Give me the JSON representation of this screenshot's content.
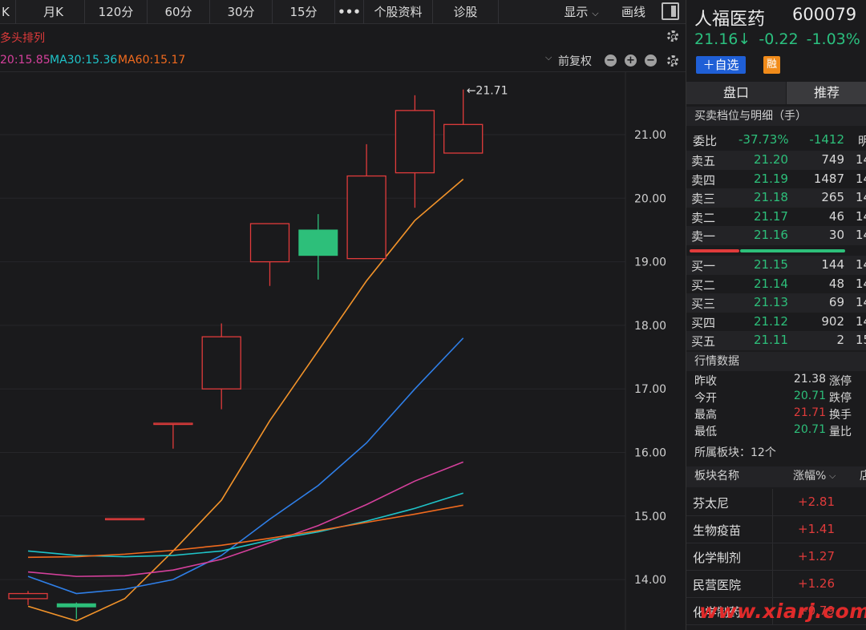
{
  "toolbar": {
    "left_stub": "K",
    "tabs": [
      "月K",
      "120分",
      "60分",
      "30分",
      "15分",
      "•••",
      "个股资料",
      "诊股"
    ],
    "display_label": "显示",
    "draw_label": "画线"
  },
  "indicator_bar": {
    "pattern_label": "多头排列",
    "ma20": "20:15.85",
    "ma30": "MA30:15.36",
    "ma60": "MA60:15.17",
    "adjust_label": "前复权"
  },
  "colors": {
    "up": "#e03b3b",
    "down": "#2dbf7a",
    "ma5": "#f2932a",
    "ma10": "#2f7fe8",
    "ma20": "#d5409c",
    "ma30": "#1fc3c8",
    "ma60": "#f06a1e",
    "axis_text": "#cfcfcf"
  },
  "chart_data": {
    "type": "candlestick",
    "y_ticks": [
      "21.00",
      "20.00",
      "19.00",
      "18.00",
      "17.00",
      "16.00",
      "15.00",
      "14.00"
    ],
    "ylim": [
      13.2,
      22.0
    ],
    "high_annotation": "←21.71",
    "candles": [
      {
        "open": 13.78,
        "close": 13.7,
        "high": 13.82,
        "low": 13.6,
        "dir": "up"
      },
      {
        "open": 13.62,
        "close": 13.57,
        "high": 13.64,
        "low": 13.38,
        "dir": "down"
      },
      {
        "open": 14.95,
        "close": 14.96,
        "high": 14.96,
        "low": 14.95,
        "dir": "up"
      },
      {
        "open": 16.45,
        "close": 16.46,
        "high": 16.46,
        "low": 16.06,
        "dir": "up"
      },
      {
        "open": 17.0,
        "close": 17.82,
        "high": 18.03,
        "low": 16.68,
        "dir": "up"
      },
      {
        "open": 19.0,
        "close": 19.6,
        "high": 19.6,
        "low": 18.62,
        "dir": "up"
      },
      {
        "open": 19.5,
        "close": 19.1,
        "high": 19.75,
        "low": 18.72,
        "dir": "down"
      },
      {
        "open": 19.05,
        "close": 20.35,
        "high": 20.85,
        "low": 19.05,
        "dir": "up"
      },
      {
        "open": 20.4,
        "close": 21.38,
        "high": 21.62,
        "low": 19.85,
        "dir": "up"
      },
      {
        "open": 20.71,
        "close": 21.16,
        "high": 21.71,
        "low": 20.71,
        "dir": "up"
      }
    ],
    "series": [
      {
        "key": "ma5",
        "values": [
          13.58,
          13.35,
          13.7,
          14.45,
          15.25,
          16.5,
          17.6,
          18.7,
          19.65,
          20.3
        ]
      },
      {
        "key": "ma10",
        "values": [
          14.05,
          13.78,
          13.85,
          14.0,
          14.38,
          14.95,
          15.48,
          16.15,
          17.0,
          17.8
        ]
      },
      {
        "key": "ma20",
        "values": [
          14.12,
          14.05,
          14.06,
          14.15,
          14.32,
          14.58,
          14.85,
          15.18,
          15.55,
          15.85
        ]
      },
      {
        "key": "ma30",
        "values": [
          14.45,
          14.38,
          14.36,
          14.38,
          14.45,
          14.62,
          14.75,
          14.92,
          15.12,
          15.36
        ]
      },
      {
        "key": "ma60",
        "values": [
          14.35,
          14.36,
          14.4,
          14.46,
          14.54,
          14.65,
          14.77,
          14.9,
          15.03,
          15.17
        ]
      }
    ]
  },
  "stock": {
    "name": "人福医药",
    "code": "600079",
    "price": "21.16↓",
    "change": "-0.22",
    "pct": "-1.03%",
    "fav_label": "＋自选",
    "margin_badge": "融"
  },
  "panel": {
    "tabs": [
      "盘口",
      "推荐"
    ],
    "orderbook_title": "买卖档位与明细（手）",
    "ratio_label": "委比",
    "ratio_pct": "-37.73%",
    "ratio_diff": "-1412",
    "ratio_extra": "明",
    "asks": [
      {
        "label": "卖五",
        "price": "21.20",
        "vol": "749",
        "extra": "14"
      },
      {
        "label": "卖四",
        "price": "21.19",
        "vol": "1487",
        "extra": "14"
      },
      {
        "label": "卖三",
        "price": "21.18",
        "vol": "265",
        "extra": "14"
      },
      {
        "label": "卖二",
        "price": "21.17",
        "vol": "46",
        "extra": "14"
      },
      {
        "label": "卖一",
        "price": "21.16",
        "vol": "30",
        "extra": "14"
      }
    ],
    "bids": [
      {
        "label": "买一",
        "price": "21.15",
        "vol": "144",
        "extra": "14"
      },
      {
        "label": "买二",
        "price": "21.14",
        "vol": "48",
        "extra": "14"
      },
      {
        "label": "买三",
        "price": "21.13",
        "vol": "69",
        "extra": "14"
      },
      {
        "label": "买四",
        "price": "21.12",
        "vol": "902",
        "extra": "14"
      },
      {
        "label": "买五",
        "price": "21.11",
        "vol": "2",
        "extra": "15"
      }
    ],
    "market_title": "行情数据",
    "stats": [
      {
        "label": "昨收",
        "value": "21.38",
        "right": "涨停",
        "color": "#d8d8d8"
      },
      {
        "label": "今开",
        "value": "20.71",
        "right": "跌停",
        "color": "#2dbf7a"
      },
      {
        "label": "最高",
        "value": "21.71",
        "right": "换手",
        "color": "#e03b3b"
      },
      {
        "label": "最低",
        "value": "20.71",
        "right": "量比",
        "color": "#2dbf7a"
      }
    ],
    "sectors_title": "所属板块：12个",
    "sector_header": {
      "name": "板块名称",
      "pct": "涨幅%",
      "sort_icon": "chevron-down-icon",
      "extra": "店"
    },
    "sectors": [
      {
        "name": "芬太尼",
        "pct": "+2.81"
      },
      {
        "name": "生物疫苗",
        "pct": "+1.41"
      },
      {
        "name": "化学制剂",
        "pct": "+1.27"
      },
      {
        "name": "民营医院",
        "pct": "+1.26"
      },
      {
        "name": "化学制药",
        "pct": "+0.79"
      }
    ],
    "watermark": "www.xiarj.com"
  }
}
